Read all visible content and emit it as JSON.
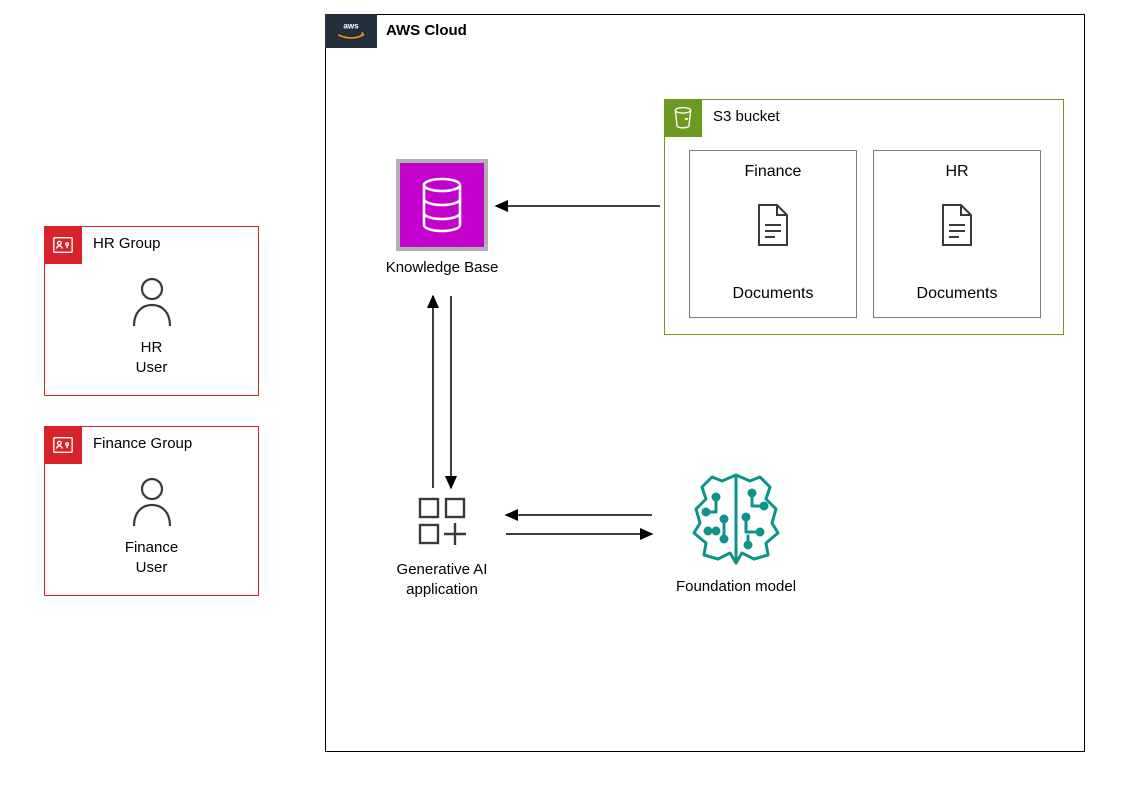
{
  "groups": {
    "hr": {
      "title": "HR Group",
      "user_label": "HR\nUser"
    },
    "finance": {
      "title": "Finance Group",
      "user_label": "Finance\nUser"
    }
  },
  "aws": {
    "title": "AWS Cloud"
  },
  "s3": {
    "title": "S3 bucket",
    "docs": [
      {
        "title": "Finance",
        "label": "Documents"
      },
      {
        "title": "HR",
        "label": "Documents"
      }
    ]
  },
  "kb": {
    "label": "Knowledge Base"
  },
  "genai": {
    "label": "Generative AI\napplication"
  },
  "fm": {
    "label": "Foundation model"
  },
  "colors": {
    "iam_red": "#d8232a",
    "s3_green": "#6a9a1f",
    "kb_purple": "#c400cc",
    "fm_teal": "#0d9488"
  }
}
